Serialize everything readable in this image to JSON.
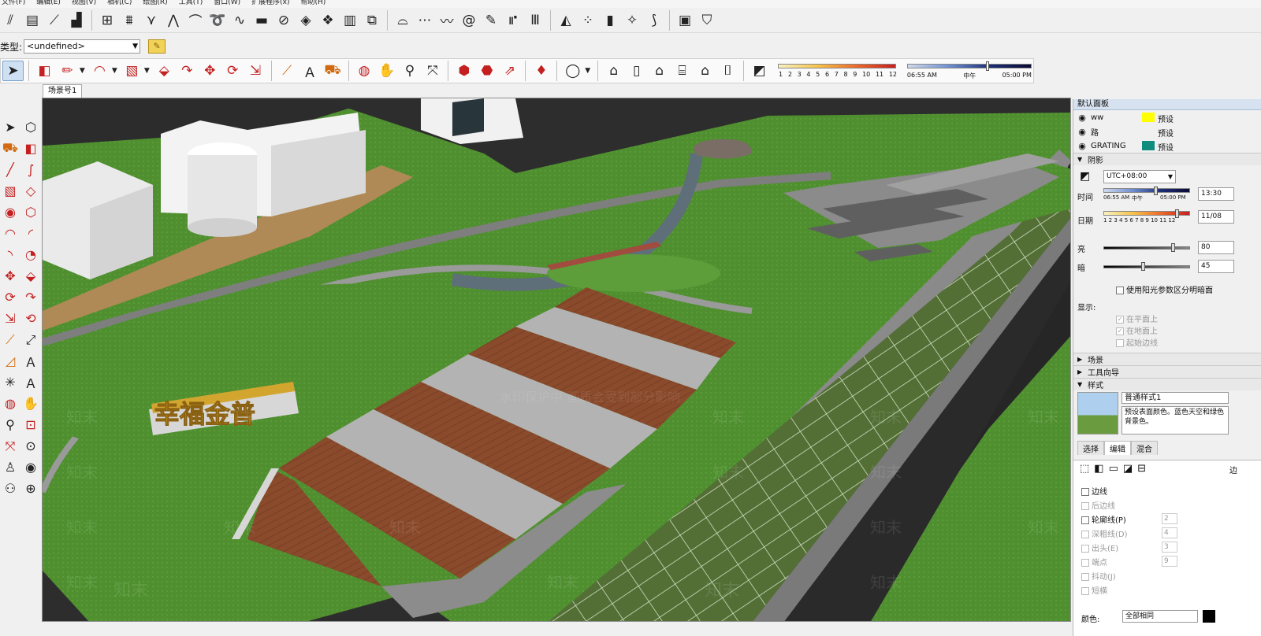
{
  "menu": [
    "文件(F)",
    "编辑(E)",
    "视图(V)",
    "相机(C)",
    "绘图(R)",
    "工具(T)",
    "窗口(W)",
    "扩展程序(x)",
    "帮助(H)"
  ],
  "type_bar": {
    "label": "类型:",
    "value": "<undefined>"
  },
  "scene_tab": "场景号1",
  "shadow_scale_numbers": [
    "1",
    "2",
    "3",
    "4",
    "5",
    "6",
    "7",
    "8",
    "9",
    "10",
    "11",
    "12"
  ],
  "time_bar": {
    "start": "06:55 AM",
    "noon": "中午",
    "end": "05:00 PM"
  },
  "tray": {
    "title": "默认面板",
    "layers": [
      {
        "name": "ww",
        "value": "预设",
        "color": "#ffff00"
      },
      {
        "name": "路",
        "value": "预设",
        "color": ""
      },
      {
        "name": "GRATING",
        "value": "预设",
        "color": "#0f8c7e"
      }
    ],
    "shadow": {
      "header": "阴影",
      "timezone": "UTC+08:00",
      "time_label": "时间",
      "time_start": "06:55 AM",
      "time_noon": "中午",
      "time_end": "05:00 PM",
      "time_value": "13:30",
      "date_label": "日期",
      "date_value": "11/08",
      "date_numbers": "1 2 3 4 5 6 7 8 9 10 11 12",
      "light_label": "亮",
      "light_value": "80",
      "light_level": 0.8,
      "dark_label": "暗",
      "dark_value": "45",
      "dark_level": 0.45,
      "sun_checkbox": "使用阳光参数区分明暗面",
      "display_label": "显示:",
      "display_options": [
        "在平面上",
        "在地面上",
        "起始边线"
      ]
    },
    "scenes_header": "场景",
    "instructor_header": "工具向导",
    "styles": {
      "header": "样式",
      "name": "普通样式1",
      "description": "预设表面颜色。蓝色天空和绿色背景色。",
      "tabs": [
        "选择",
        "编辑",
        "混合"
      ],
      "active_tab": "编辑",
      "edge_options": [
        {
          "label": "边线",
          "enabled": true,
          "value": ""
        },
        {
          "label": "后边线",
          "enabled": false,
          "value": ""
        },
        {
          "label": "轮廓线(P)",
          "enabled": true,
          "value": "2"
        },
        {
          "label": "深粗线(D)",
          "enabled": false,
          "value": "4"
        },
        {
          "label": "出头(E)",
          "enabled": false,
          "value": "3"
        },
        {
          "label": "端点",
          "enabled": false,
          "value": "9"
        },
        {
          "label": "抖动(J)",
          "enabled": false,
          "value": ""
        },
        {
          "label": "短横",
          "enabled": false,
          "value": ""
        }
      ],
      "color_label": "颜色:",
      "color_value": "全部相同",
      "side_label": "边"
    }
  },
  "viewport": {
    "sign_text": "幸福金普",
    "watermark_center": "水印保护中 画质会受到部分影响",
    "watermark_tile": "知末"
  }
}
